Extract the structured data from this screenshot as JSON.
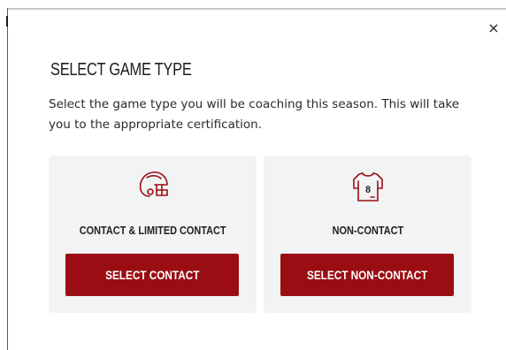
{
  "dialog": {
    "close_label": "×",
    "title": "SELECT GAME TYPE",
    "description": "Select the game type you will be coaching this season. This will take you to the appropriate certification.",
    "accent_color": "#9a0e13"
  },
  "cards": [
    {
      "icon": "football-helmet-icon",
      "label": "CONTACT & LIMITED CONTACT",
      "button_label": "SELECT CONTACT"
    },
    {
      "icon": "jersey-icon",
      "label": "NON-CONTACT",
      "jersey_number": "8",
      "button_label": "SELECT NON-CONTACT"
    }
  ]
}
